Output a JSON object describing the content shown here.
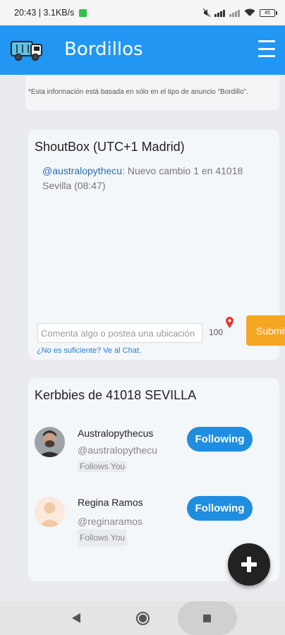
{
  "status_bar": {
    "time_speed": "20:43 | 3.1KB/s",
    "battery": "45"
  },
  "header": {
    "title": "Bordillos",
    "logo": "truck-logo",
    "menu_icon": "hamburger-menu-icon",
    "color": "#2196f3"
  },
  "disclaimer": {
    "text": "*Esta información está basada en sólo en el tipo de anuncio \"Bordillo\"."
  },
  "shoutbox": {
    "title": "ShoutBox (UTC+1 Madrid)",
    "messages": [
      {
        "handle": "@australopythecu",
        "text": ": Nuevo cambio 1 en 41018 Sevilla (08:47)"
      }
    ],
    "input_placeholder": "Comenta algo o postea una ubicación",
    "counter": "100",
    "submit_label": "Submit",
    "chat_link": "¿No es suficiente? Ve al Chat.",
    "submit_color": "#f5a623"
  },
  "kerbbies": {
    "title": "Kerbbies de 41018 SEVILLA",
    "people": [
      {
        "name": "Australopythecus",
        "handle": "@australopythecu",
        "badge": "Follows You",
        "button": "Following"
      },
      {
        "name": "Regina Ramos",
        "handle": "@reginaramos",
        "badge": "Follows You",
        "button": "Following"
      }
    ]
  },
  "fab": {
    "icon": "plus-icon"
  },
  "nav": {
    "back": "back-icon",
    "home": "home-icon",
    "recent": "recent-apps-icon"
  }
}
